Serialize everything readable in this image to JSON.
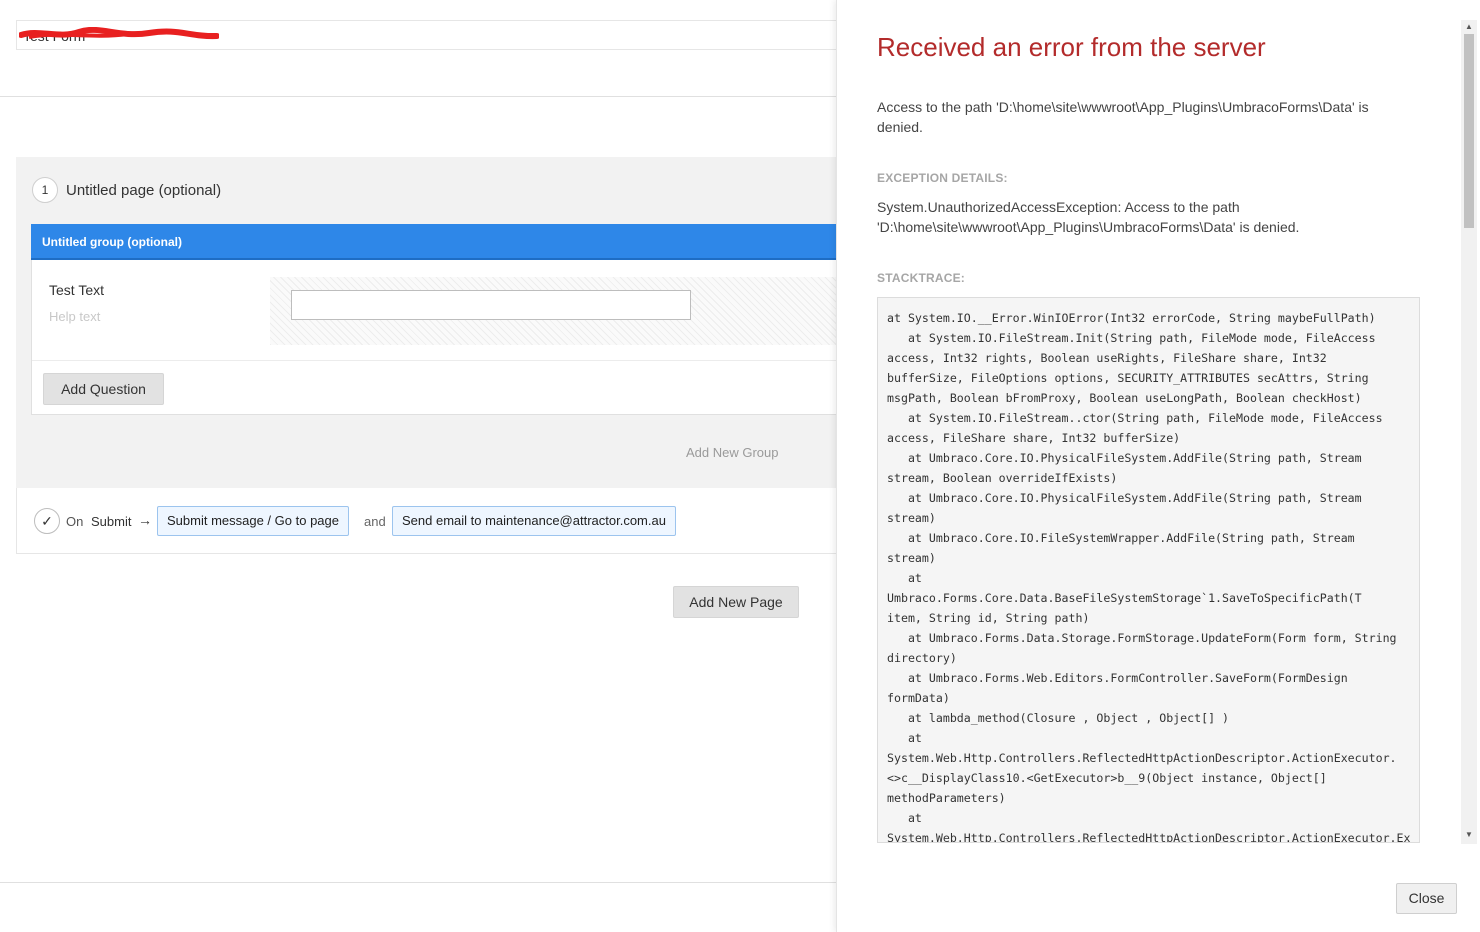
{
  "form": {
    "name": "Test Form"
  },
  "page": {
    "number": "1",
    "title": "Untitled page (optional)"
  },
  "group": {
    "title": "Untitled group (optional)",
    "question": {
      "label": "Test Text",
      "help": "Help text"
    },
    "add_question_label": "Add Question"
  },
  "add_group_label": "Add New Group",
  "submit": {
    "check_icon": "check-icon",
    "on_label": "On",
    "submit_label": "Submit",
    "arrow": "→",
    "message_action": "Submit message / Go to page",
    "and_label": "and",
    "email_action": "Send email to maintenance@attractor.com.au"
  },
  "add_page_label": "Add New Page",
  "error": {
    "title": "Received an error from the server",
    "message": "Access to the path 'D:\\home\\site\\wwwroot\\App_Plugins\\UmbracoForms\\Data' is denied.",
    "exception_label": "EXCEPTION DETAILS:",
    "exception_text": "System.UnauthorizedAccessException: Access to the path 'D:\\home\\site\\wwwroot\\App_Plugins\\UmbracoForms\\Data' is denied.",
    "stacktrace_label": "STACKTRACE:",
    "stacktrace_lines": [
      "at System.IO.__Error.WinIOError(Int32 errorCode, String maybeFullPath)",
      "   at System.IO.FileStream.Init(String path, FileMode mode, FileAccess",
      "access, Int32 rights, Boolean useRights, FileShare share, Int32",
      "bufferSize, FileOptions options, SECURITY_ATTRIBUTES secAttrs, String",
      "msgPath, Boolean bFromProxy, Boolean useLongPath, Boolean checkHost)",
      "   at System.IO.FileStream..ctor(String path, FileMode mode, FileAccess",
      "access, FileShare share, Int32 bufferSize)",
      "   at Umbraco.Core.IO.PhysicalFileSystem.AddFile(String path, Stream",
      "stream, Boolean overrideIfExists)",
      "   at Umbraco.Core.IO.PhysicalFileSystem.AddFile(String path, Stream",
      "stream)",
      "   at Umbraco.Core.IO.FileSystemWrapper.AddFile(String path, Stream",
      "stream)",
      "   at",
      "Umbraco.Forms.Core.Data.BaseFileSystemStorage`1.SaveToSpecificPath(T",
      "item, String id, String path)",
      "   at Umbraco.Forms.Data.Storage.FormStorage.UpdateForm(Form form, String",
      "directory)",
      "   at Umbraco.Forms.Web.Editors.FormController.SaveForm(FormDesign",
      "formData)",
      "   at lambda_method(Closure , Object , Object[] )",
      "   at",
      "System.Web.Http.Controllers.ReflectedHttpActionDescriptor.ActionExecutor.",
      "<>c__DisplayClass10.<GetExecutor>b__9(Object instance, Object[]",
      "methodParameters)",
      "   at",
      "System.Web.Http.Controllers.ReflectedHttpActionDescriptor.ActionExecutor.Ex"
    ],
    "close_label": "Close"
  },
  "colors": {
    "accent": "#2e87e8",
    "error_title": "#b32b2b"
  }
}
